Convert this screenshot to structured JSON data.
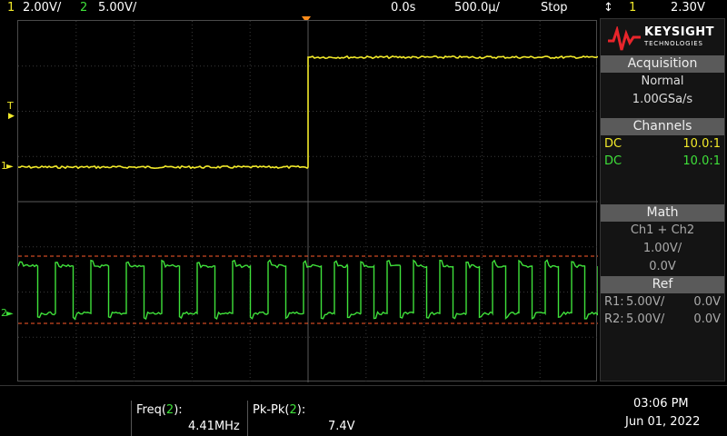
{
  "topbar": {
    "ch1_num": "1",
    "ch1_scale": "2.00V/",
    "ch2_num": "2",
    "ch2_scale": "5.00V/",
    "time_pos": "0.0s",
    "time_scale": "500.0µ/",
    "run_state": "Stop",
    "trig_icon": "↕",
    "trig_ch": "1",
    "trig_level": "2.30V"
  },
  "markers": {
    "ch1": "1",
    "ch2": "2",
    "trig": "T"
  },
  "panel": {
    "brand": "KEYSIGHT",
    "brand_sub": "TECHNOLOGIES",
    "acq_title": "Acquisition",
    "acq_mode": "Normal",
    "acq_rate": "1.00GSa/s",
    "channels_title": "Channels",
    "ch1_coupling": "DC",
    "ch1_probe": "10.0:1",
    "ch2_coupling": "DC",
    "ch2_probe": "10.0:1",
    "math_title": "Math",
    "math_func": "Ch1 + Ch2",
    "math_scale": "1.00V/",
    "math_offset": "0.0V",
    "ref_title": "Ref",
    "r1_label": "R1:",
    "r1_scale": "5.00V/",
    "r1_offset": "0.0V",
    "r2_label": "R2:",
    "r2_scale": "5.00V/",
    "r2_offset": "0.0V"
  },
  "bottombar": {
    "freq_label": "Freq(",
    "freq_ch": "2",
    "freq_label_end": "):",
    "freq_value": "4.41MHz",
    "pkpk_label": "Pk-Pk(",
    "pkpk_ch": "2",
    "pkpk_label_end": "):",
    "pkpk_value": "7.4V",
    "time": "03:06 PM",
    "date": "Jun 01, 2022"
  },
  "colors": {
    "ch1": "#f2ea2a",
    "ch2": "#3fe03a",
    "trigger": "#ff8c1a",
    "cursor": "#ff5a2a"
  }
}
